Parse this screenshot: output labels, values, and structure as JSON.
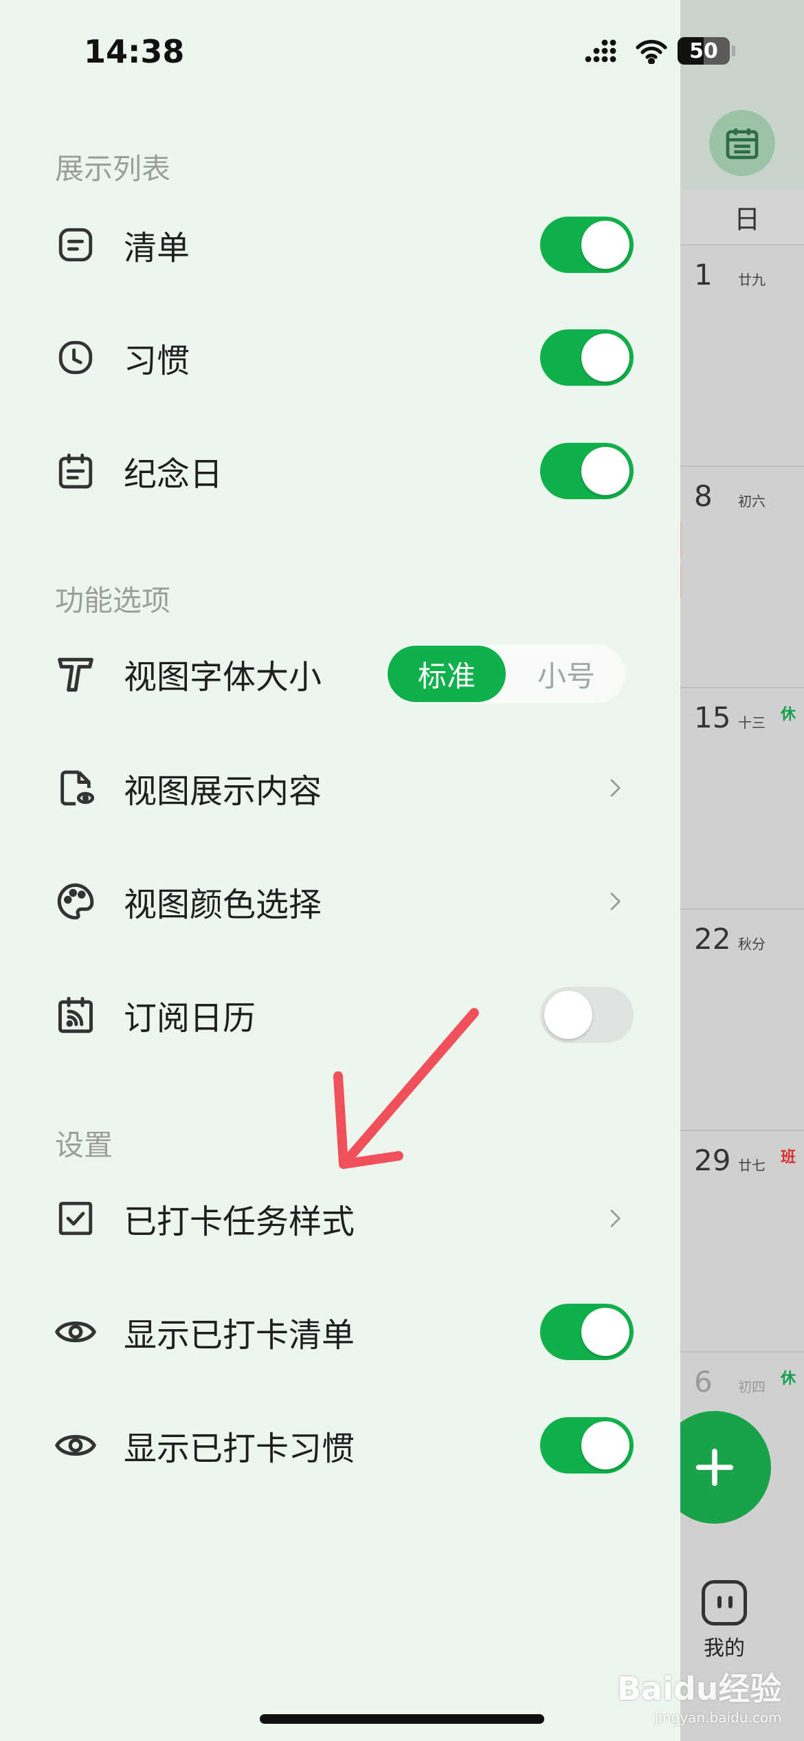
{
  "status_bar": {
    "time": "14:38",
    "battery": "50"
  },
  "sections": {
    "display_list": "展示列表",
    "features": "功能选项",
    "settings": "设置"
  },
  "rows": {
    "list": {
      "label": "清单",
      "enabled": true
    },
    "habit": {
      "label": "习惯",
      "enabled": true
    },
    "anniversary": {
      "label": "纪念日",
      "enabled": true
    },
    "font_size": {
      "label": "视图字体大小",
      "options": [
        "标准",
        "小号"
      ],
      "selected": "标准"
    },
    "view_content": {
      "label": "视图展示内容"
    },
    "view_color": {
      "label": "视图颜色选择"
    },
    "subscribe_calendar": {
      "label": "订阅日历",
      "enabled": false
    },
    "checked_task_style": {
      "label": "已打卡任务样式"
    },
    "show_checked_list": {
      "label": "显示已打卡清单",
      "enabled": true
    },
    "show_checked_habit": {
      "label": "显示已打卡习惯",
      "enabled": true
    }
  },
  "calendar": {
    "weekday": "日",
    "cells": [
      {
        "day": "1",
        "lunar": "廿九",
        "tag": ""
      },
      {
        "day": "8",
        "lunar": "初六",
        "tag": ""
      },
      {
        "day": "15",
        "lunar": "十三",
        "tag": "休"
      },
      {
        "day": "22",
        "lunar": "秋分",
        "tag": ""
      },
      {
        "day": "29",
        "lunar": "廿七",
        "tag": "班"
      },
      {
        "day": "6",
        "lunar": "初四",
        "tag": "休"
      }
    ],
    "me_label": "我的"
  },
  "colors": {
    "accent": "#10b04a",
    "arrow": "#f0505a",
    "rest_tag": "#12a150",
    "work_tag": "#d93030"
  },
  "watermark": {
    "brand": "Baidu经验",
    "url": "jingyan.baidu.com"
  }
}
